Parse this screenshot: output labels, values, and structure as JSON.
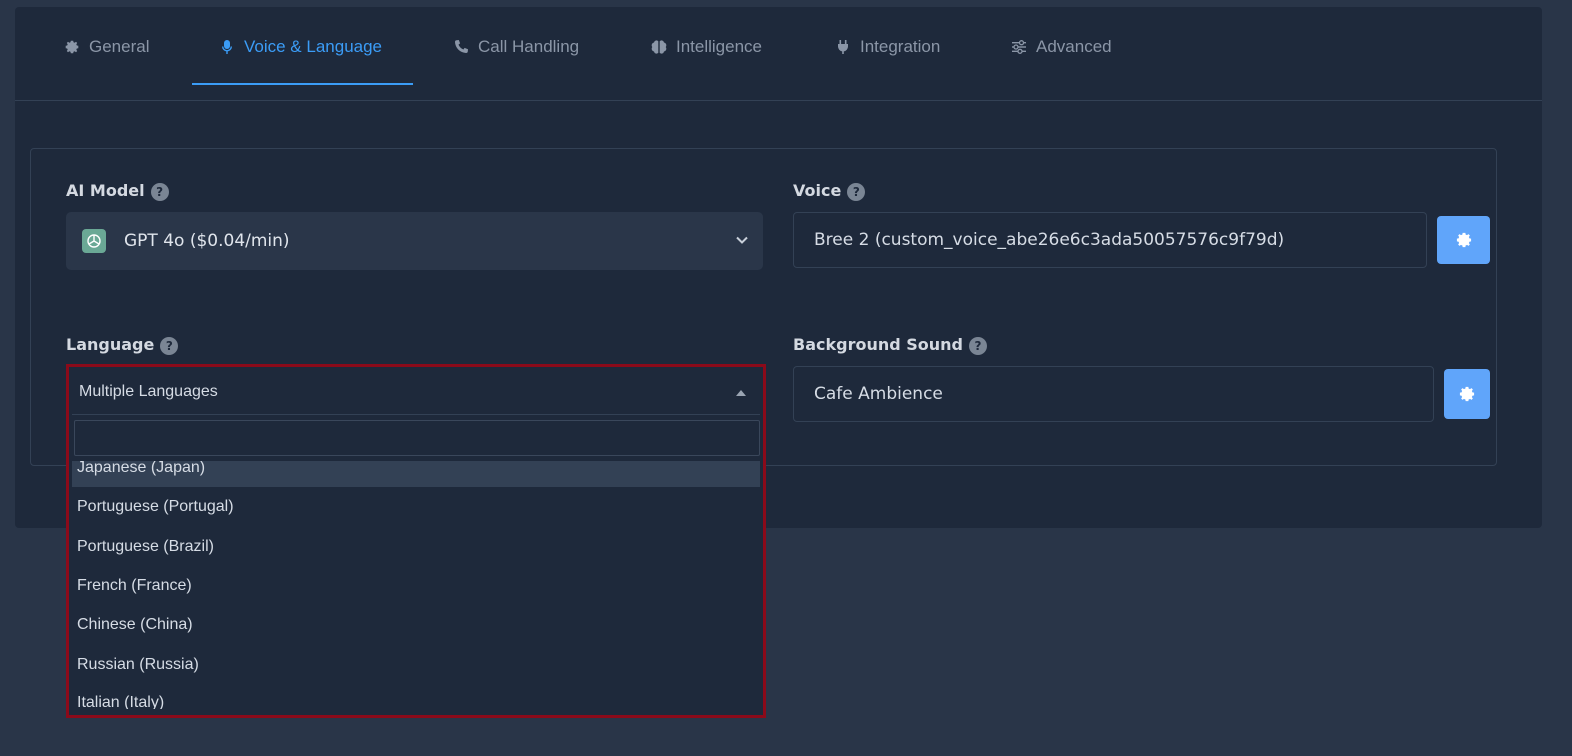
{
  "tabs": [
    {
      "label": "General",
      "icon": "gear-icon"
    },
    {
      "label": "Voice & Language",
      "icon": "microphone-icon"
    },
    {
      "label": "Call Handling",
      "icon": "phone-icon"
    },
    {
      "label": "Intelligence",
      "icon": "brain-icon"
    },
    {
      "label": "Integration",
      "icon": "plug-icon"
    },
    {
      "label": "Advanced",
      "icon": "sliders-icon"
    }
  ],
  "active_tab": "Voice & Language",
  "ai_model": {
    "label": "AI Model",
    "help": "?",
    "value": "GPT 4o ($0.04/min)"
  },
  "voice": {
    "label": "Voice",
    "help": "?",
    "value": "Bree 2 (custom_voice_abe26e6c3ada50057576c9f79d)"
  },
  "language": {
    "label": "Language",
    "help": "?",
    "value": "Multiple Languages",
    "search_value": "",
    "options": [
      "Japanese (Japan)",
      "Portuguese (Portugal)",
      "Portuguese (Brazil)",
      "French (France)",
      "Chinese (China)",
      "Russian (Russia)",
      "Italian (Italy)"
    ],
    "highlighted": "Japanese (Japan)"
  },
  "background_sound": {
    "label": "Background Sound",
    "help": "?",
    "value": "Cafe Ambience"
  },
  "colors": {
    "accent": "#3b9cf6",
    "button": "#60a5fa",
    "focus_border": "#8b0a1a",
    "panel": "#1e293b",
    "page": "#293548"
  }
}
